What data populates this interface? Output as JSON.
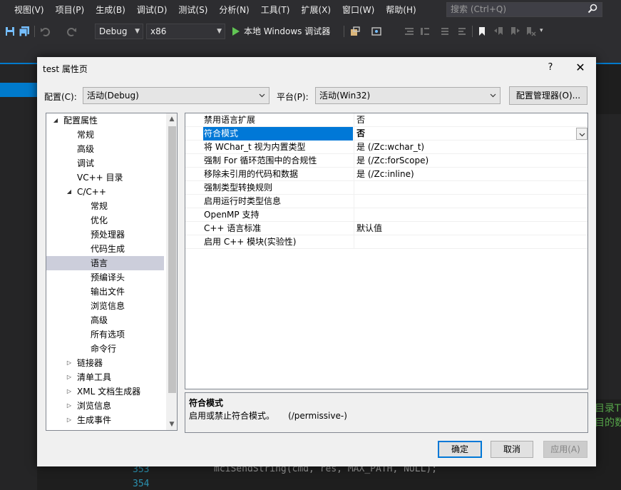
{
  "menubar": {
    "items": [
      "视图(V)",
      "项目(P)",
      "生成(B)",
      "调试(D)",
      "测试(S)",
      "分析(N)",
      "工具(T)",
      "扩展(X)",
      "窗口(W)",
      "帮助(H)"
    ],
    "search_placeholder": "搜索 (Ctrl+Q)"
  },
  "toolbar": {
    "config": "Debug",
    "platform": "x86",
    "run_label": "本地 Windows 调试器"
  },
  "editor": {
    "line_numbers": [
      "353",
      "354"
    ],
    "code": "mciSendString(cmd, res, MAX_PATH, NULL);",
    "comment_fragments": [
      "目录T",
      "目的数"
    ]
  },
  "dialog": {
    "title": "test 属性页",
    "help_glyph": "?",
    "close_glyph": "✕",
    "config_label": "配置(C):",
    "config_value": "活动(Debug)",
    "platform_label": "平台(P):",
    "platform_value": "活动(Win32)",
    "config_manager_button": "配置管理器(O)...",
    "tree": [
      {
        "label": "配置属性",
        "level": 0,
        "expander": "open"
      },
      {
        "label": "常规",
        "level": 1,
        "expander": "none"
      },
      {
        "label": "高级",
        "level": 1,
        "expander": "none"
      },
      {
        "label": "调试",
        "level": 1,
        "expander": "none"
      },
      {
        "label": "VC++ 目录",
        "level": 1,
        "expander": "none"
      },
      {
        "label": "C/C++",
        "level": 1,
        "expander": "open"
      },
      {
        "label": "常规",
        "level": 2,
        "expander": "none"
      },
      {
        "label": "优化",
        "level": 2,
        "expander": "none"
      },
      {
        "label": "预处理器",
        "level": 2,
        "expander": "none"
      },
      {
        "label": "代码生成",
        "level": 2,
        "expander": "none"
      },
      {
        "label": "语言",
        "level": 2,
        "expander": "none",
        "selected": true
      },
      {
        "label": "预编译头",
        "level": 2,
        "expander": "none"
      },
      {
        "label": "输出文件",
        "level": 2,
        "expander": "none"
      },
      {
        "label": "浏览信息",
        "level": 2,
        "expander": "none"
      },
      {
        "label": "高级",
        "level": 2,
        "expander": "none"
      },
      {
        "label": "所有选项",
        "level": 2,
        "expander": "none"
      },
      {
        "label": "命令行",
        "level": 2,
        "expander": "none"
      },
      {
        "label": "链接器",
        "level": 1,
        "expander": "closed"
      },
      {
        "label": "清单工具",
        "level": 1,
        "expander": "closed"
      },
      {
        "label": "XML 文档生成器",
        "level": 1,
        "expander": "closed"
      },
      {
        "label": "浏览信息",
        "level": 1,
        "expander": "closed"
      },
      {
        "label": "生成事件",
        "level": 1,
        "expander": "closed"
      }
    ],
    "properties": [
      {
        "name": "禁用语言扩展",
        "value": "否"
      },
      {
        "name": "符合模式",
        "value": "否",
        "selected": true
      },
      {
        "name": "将 WChar_t 视为内置类型",
        "value": "是 (/Zc:wchar_t)"
      },
      {
        "name": "强制 For 循环范围中的合规性",
        "value": "是 (/Zc:forScope)"
      },
      {
        "name": "移除未引用的代码和数据",
        "value": "是 (/Zc:inline)"
      },
      {
        "name": "强制类型转换规则",
        "value": ""
      },
      {
        "name": "启用运行时类型信息",
        "value": ""
      },
      {
        "name": "OpenMP 支持",
        "value": ""
      },
      {
        "name": "C++ 语言标准",
        "value": "默认值"
      },
      {
        "name": "启用 C++ 模块(实验性)",
        "value": ""
      }
    ],
    "description": {
      "title": "符合模式",
      "text": "启用或禁止符合模式。     (/permissive-)"
    },
    "buttons": {
      "ok": "确定",
      "cancel": "取消",
      "apply": "应用(A)"
    }
  },
  "colors": {
    "accent": "#0078d7",
    "vs_blue": "#007acc",
    "tree_selected": "#cccedb"
  }
}
